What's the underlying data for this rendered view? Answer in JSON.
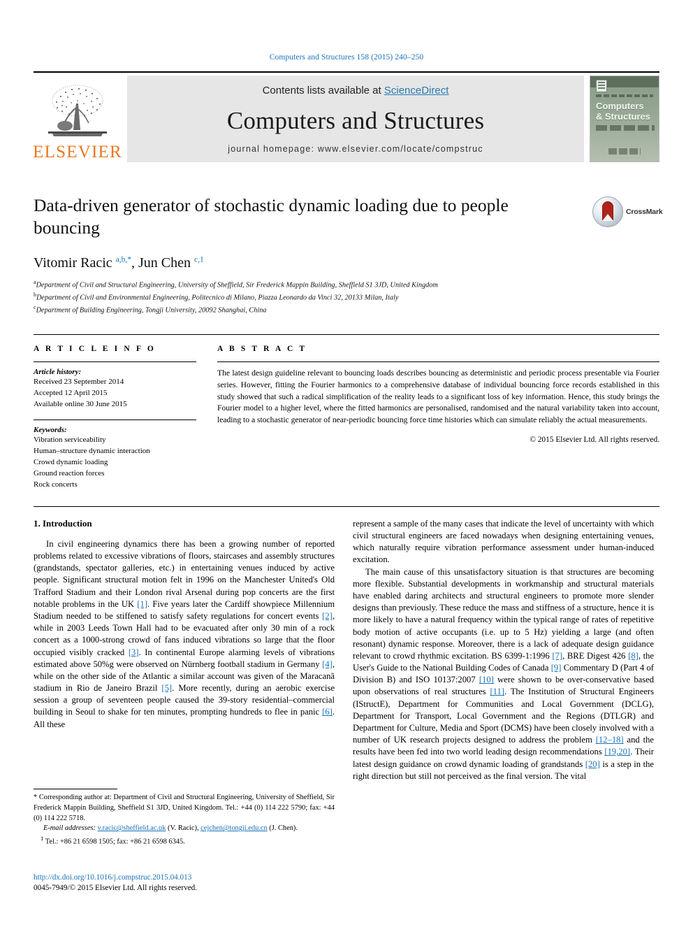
{
  "running_head": "Computers and Structures 158 (2015) 240–250",
  "masthead": {
    "publisher_logo_text": "ELSEVIER",
    "contents_prefix": "Contents lists available at ",
    "contents_link": "ScienceDirect",
    "journal_title": "Computers and Structures",
    "homepage": "journal homepage: www.elsevier.com/locate/compstruc",
    "cover": {
      "title_line1": "Computers",
      "title_line2": "& Structures"
    }
  },
  "article": {
    "title": "Data-driven generator of stochastic dynamic loading due to people bouncing",
    "crossmark_label": "CrossMark",
    "authors_html": "Vitomir Racic <sup>a,b,</sup><sup>*</sup>, Jun Chen <sup>c,1</sup>",
    "affiliations": [
      {
        "marker": "a",
        "text": "Department of Civil and Structural Engineering, University of Sheffield, Sir Frederick Mappin Building, Sheffield S1 3JD, United Kingdom"
      },
      {
        "marker": "b",
        "text": "Department of Civil and Environmental Engineering, Politecnico di Milano, Piazza Leonardo da Vinci 32, 20133 Milan, Italy"
      },
      {
        "marker": "c",
        "text": "Department of Building Engineering, Tongji University, 20092 Shanghai, China"
      }
    ]
  },
  "article_info": {
    "heading": "A R T I C L E    I N F O",
    "history_label": "Article history:",
    "history": [
      "Received 23 September 2014",
      "Accepted 12 April 2015",
      "Available online 30 June 2015"
    ],
    "keywords_label": "Keywords:",
    "keywords": [
      "Vibration serviceability",
      "Human–structure dynamic interaction",
      "Crowd dynamic loading",
      "Ground reaction forces",
      "Rock concerts"
    ]
  },
  "abstract": {
    "heading": "A B S T R A C T",
    "text": "The latest design guideline relevant to bouncing loads describes bouncing as deterministic and periodic process presentable via Fourier series. However, fitting the Fourier harmonics to a comprehensive database of individual bouncing force records established in this study showed that such a radical simplification of the reality leads to a significant loss of key information. Hence, this study brings the Fourier model to a higher level, where the fitted harmonics are personalised, randomised and the natural variability taken into account, leading to a stochastic generator of near-periodic bouncing force time histories which can simulate reliably the actual measurements.",
    "copyright": "© 2015 Elsevier Ltd. All rights reserved."
  },
  "body": {
    "section_title": "1. Introduction",
    "left_paragraph_1_parts": [
      "In civil engineering dynamics there has been a growing number of reported problems related to excessive vibrations of floors, staircases and assembly structures (grandstands, spectator galleries, etc.) in entertaining venues induced by active people. Significant structural motion felt in 1996 on the Manchester United's Old Trafford Stadium and their London rival Arsenal during pop concerts are the first notable problems in the UK ",
      "[1]",
      ". Five years later the Cardiff showpiece Millennium Stadium needed to be stiffened to satisfy safety regulations for concert events ",
      "[2]",
      ", while in 2003 Leeds Town Hall had to be evacuated after only 30 min of a rock concert as a 1000-strong crowd of fans induced vibrations so large that the floor occupied visibly cracked ",
      "[3]",
      ". In continental Europe alarming levels of vibrations estimated above 50%g were observed on Nürnberg football stadium in Germany ",
      "[4]",
      ", while on the other side of the Atlantic a similar account was given of the Maracanã stadium in Rio de Janeiro Brazil ",
      "[5]",
      ". More recently, during an aerobic exercise session a group of seventeen people caused the 39-story residential–commercial building in Seoul to shake for ten minutes, prompting hundreds to flee in panic ",
      "[6]",
      ". All these"
    ],
    "right_paragraph_1": "represent a sample of the many cases that indicate the level of uncertainty with which civil structural engineers are faced nowadays when designing entertaining venues, which naturally require vibration performance assessment under human-induced excitation.",
    "right_paragraph_2_parts": [
      "The main cause of this unsatisfactory situation is that structures are becoming more flexible. Substantial developments in workmanship and structural materials have enabled daring architects and structural engineers to promote more slender designs than previously. These reduce the mass and stiffness of a structure, hence it is more likely to have a natural frequency within the typical range of rates of repetitive body motion of active occupants (i.e. up to 5 Hz) yielding a large (and often resonant) dynamic response. Moreover, there is a lack of adequate design guidance relevant to crowd rhythmic excitation. BS 6399-1:1996 ",
      "[7]",
      ", BRE Digest 426 ",
      "[8]",
      ", the User's Guide to the National Building Codes of Canada ",
      "[9]",
      " Commentary D (Part 4 of Division B) and ISO 10137:2007 ",
      "[10]",
      " were shown to be over-conservative based upon observations of real structures ",
      "[11]",
      ". The Institution of Structural Engineers (IStructE), Department for Communities and Local Government (DCLG), Department for Transport, Local Government and the Regions (DTLGR) and Department for Culture, Media and Sport (DCMS) have been closely involved with a number of UK research projects designed to address the problem ",
      "[12–18]",
      " and the results have been fed into two world leading design recommendations ",
      "[19,20]",
      ". Their latest design guidance on crowd dynamic loading of grandstands ",
      "[20]",
      " is a step in the right direction but still not perceived as the final version. The vital"
    ]
  },
  "footnotes": {
    "corresponding_parts": [
      "* Corresponding author at: Department of Civil and Structural Engineering, University of Sheffield, Sir Frederick Mappin Building, Sheffield S1 3JD, United Kingdom. Tel.: +44 (0) 114 222 5790; fax: +44 (0) 114 222 5718."
    ],
    "email_label": "E-mail addresses:",
    "email_1": "v.racic@sheffield.ac.uk",
    "email_1_owner": "(V. Racic)",
    "email_2": "cejchen@tongji.edu.cn",
    "email_2_owner": "(J. Chen).",
    "note_1": "Tel.: +86 21 6598 1505; fax: +86 21 6598 6345.",
    "note_1_marker": "1"
  },
  "imprint": {
    "doi": "http://dx.doi.org/10.1016/j.compstruc.2015.04.013",
    "issn_line": "0045-7949/© 2015 Elsevier Ltd. All rights reserved."
  },
  "colors": {
    "link_blue": "#1b72b8",
    "sciencedirect_blue": "#2a7ab0",
    "elsevier_orange": "#e87722",
    "panel_grey": "#e6e6e6"
  }
}
